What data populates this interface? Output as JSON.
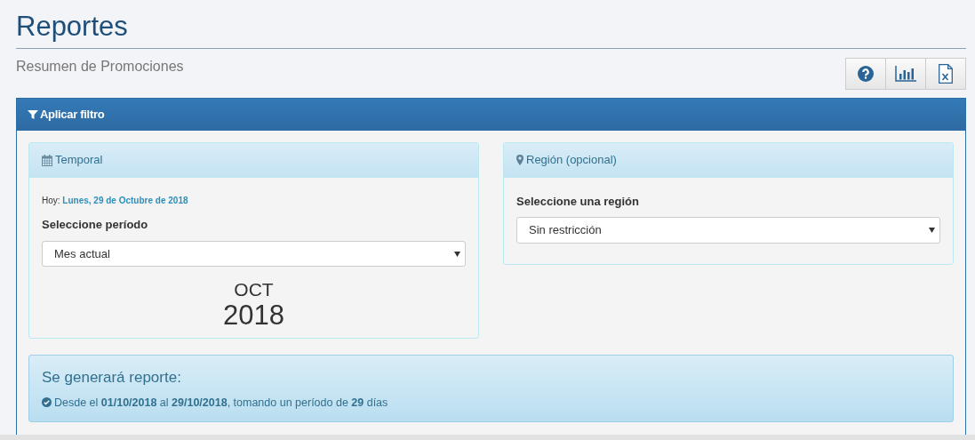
{
  "page": {
    "title": "Reportes",
    "subtitle": "Resumen de Promociones"
  },
  "toolbar": [
    {
      "kind": "help"
    },
    {
      "kind": "chart"
    },
    {
      "kind": "excel"
    }
  ],
  "filter_panel": {
    "title": "Aplicar filtro",
    "temporal": {
      "title": "Temporal",
      "today_label": "Hoy:",
      "today_value": "Lunes, 29 de Octubre de 2018",
      "label": "Seleccione período",
      "value": "Mes actual",
      "month": "OCT",
      "year": "2018"
    },
    "region": {
      "title": "Región (opcional)",
      "label": "Seleccione una región",
      "value": "Sin restricción"
    },
    "summary": {
      "title": "Se generará reporte:",
      "text": "Desde el **01/10/2018** al **29/10/2018**, tomando un período de **29** días"
    }
  }
}
